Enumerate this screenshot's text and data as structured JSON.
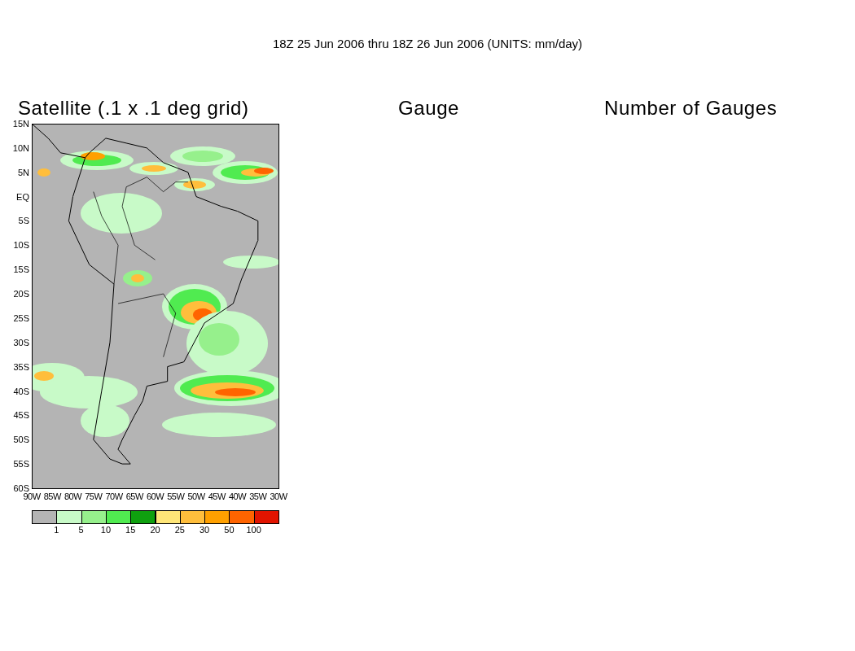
{
  "title": "18Z 25 Jun 2006 thru 18Z 26 Jun 2006 (UNITS: mm/day)",
  "panels": [
    {
      "title": "Satellite (.1 x .1 deg grid)"
    },
    {
      "title": "Gauge"
    },
    {
      "title": "Number of Gauges"
    }
  ],
  "map": {
    "lat_labels": [
      "15N",
      "10N",
      "5N",
      "EQ",
      "5S",
      "10S",
      "15S",
      "20S",
      "25S",
      "30S",
      "35S",
      "40S",
      "45S",
      "50S",
      "55S",
      "60S"
    ],
    "lon_labels": [
      "90W",
      "85W",
      "80W",
      "75W",
      "70W",
      "65W",
      "60W",
      "55W",
      "50W",
      "45W",
      "40W",
      "35W",
      "30W"
    ]
  },
  "colorbar": {
    "segments": [
      {
        "color": "#b4b4b4"
      },
      {
        "color": "#c8fac8"
      },
      {
        "color": "#96f08c"
      },
      {
        "color": "#50eb50"
      },
      {
        "color": "#0fa00f"
      },
      {
        "color": "#ffe678"
      },
      {
        "color": "#ffbe3c"
      },
      {
        "color": "#ffa000"
      },
      {
        "color": "#ff6400"
      },
      {
        "color": "#e11400"
      }
    ],
    "labels": [
      "1",
      "5",
      "10",
      "15",
      "20",
      "25",
      "30",
      "50",
      "100"
    ]
  }
}
